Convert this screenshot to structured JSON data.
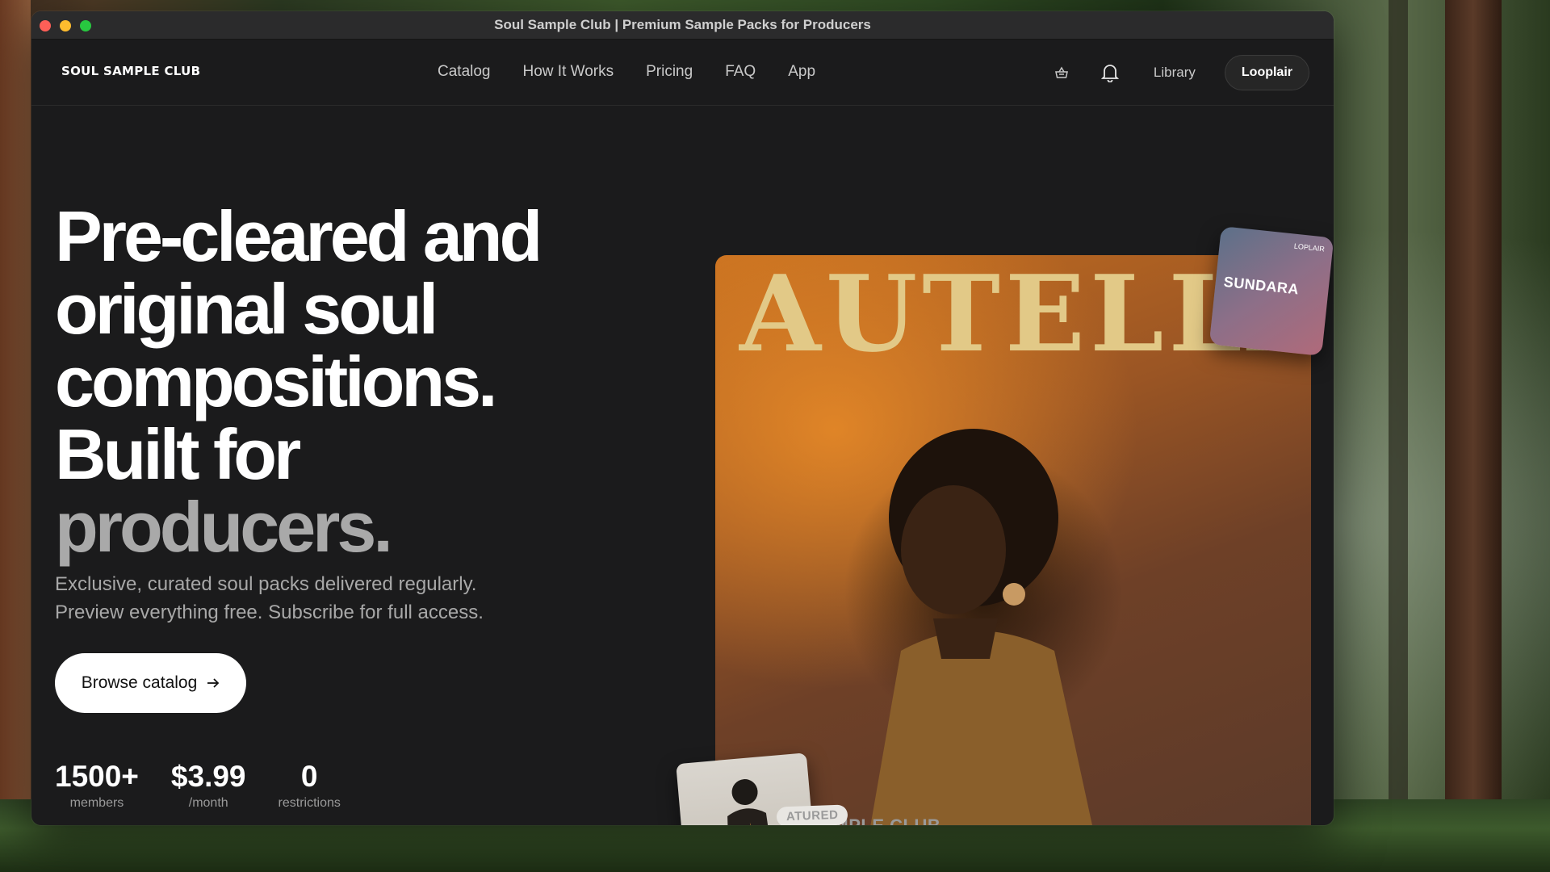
{
  "window": {
    "title": "Soul Sample Club | Premium Sample Packs for Producers"
  },
  "nav": {
    "logo": "SOUL SAMPLE CLUB",
    "links": [
      "Catalog",
      "How It Works",
      "Pricing",
      "FAQ",
      "App"
    ],
    "library": "Library",
    "account_button": "Looplair"
  },
  "hero": {
    "headline_lines": [
      "Pre-cleared and",
      "original soul",
      "compositions.",
      "Built for",
      "producers."
    ],
    "subtext_lines": [
      "Exclusive, curated soul packs delivered regularly.",
      "Preview everything free. Subscribe for full access."
    ],
    "cta_label": "Browse catalog",
    "stats": [
      {
        "value": "1500+",
        "label": "members"
      },
      {
        "value": "$3.99",
        "label": "/month"
      },
      {
        "value": "0",
        "label": "restrictions"
      }
    ]
  },
  "artwork": {
    "main_cover_title": "AUTELLA",
    "main_cover_footer": "AMPLE CLUB",
    "sundara_card_title": "SUNDARA",
    "sundara_card_corner": "LOPLAIR",
    "featured_pill": "ATURED"
  },
  "colors": {
    "window_bg": "#1b1b1c",
    "titlebar_bg": "#2b2b2c",
    "accent_cover": "#c66f20",
    "traffic_close": "#ff5f57",
    "traffic_min": "#febc2e",
    "traffic_max": "#28c840"
  }
}
